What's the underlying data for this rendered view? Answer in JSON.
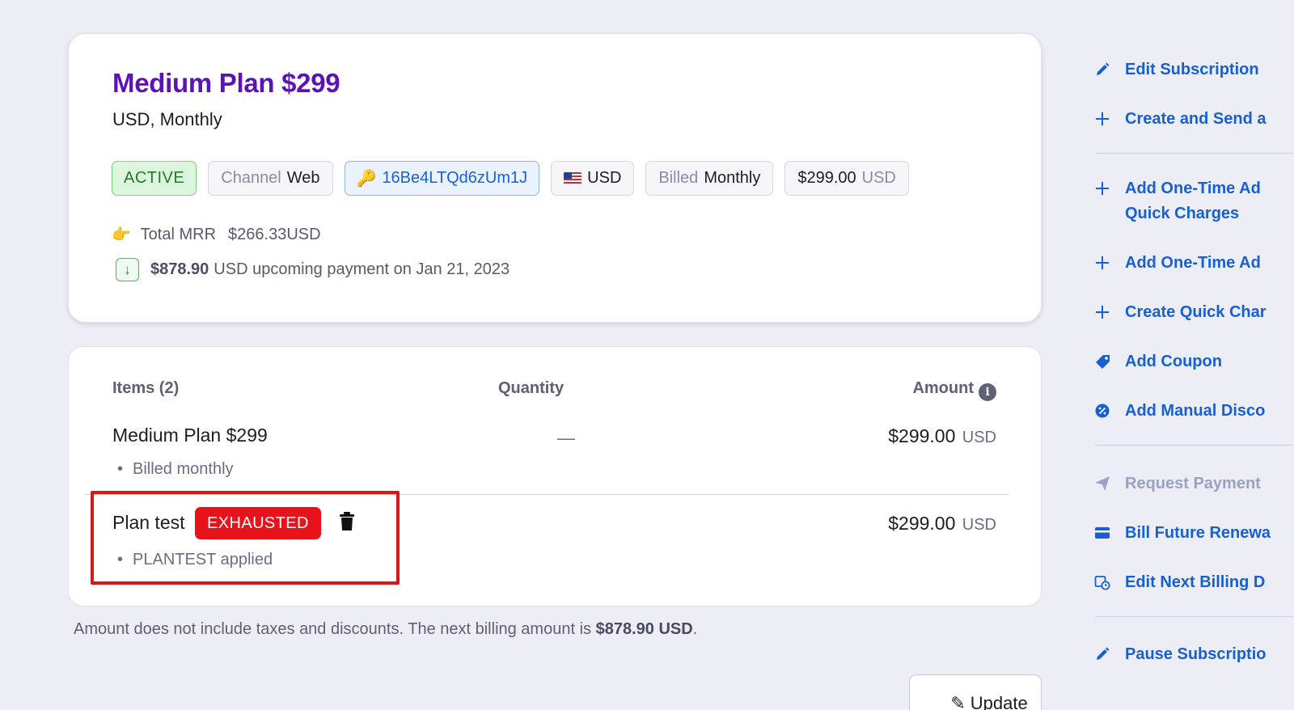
{
  "plan": {
    "title": "Medium Plan $299",
    "subtitle": "USD, Monthly",
    "chips": {
      "status": "ACTIVE",
      "channel_label": "Channel",
      "channel_value": "Web",
      "subscription_id": "16Be4LTQd6zUm1J",
      "currency": "USD",
      "billed_label": "Billed",
      "billed_value": "Monthly",
      "price": "$299.00",
      "price_currency": "USD"
    },
    "mrr_label": "Total MRR",
    "mrr_value": "$266.33USD",
    "upcoming_amount": "$878.90",
    "upcoming_text": "USD upcoming payment on Jan 21, 2023"
  },
  "items": {
    "header_items": "Items (2)",
    "header_quantity": "Quantity",
    "header_amount": "Amount",
    "rows": [
      {
        "name": "Medium Plan $299",
        "detail": "Billed monthly",
        "quantity": "—",
        "amount": "$299.00",
        "currency": "USD"
      },
      {
        "name": "Plan test",
        "badge": "EXHAUSTED",
        "detail": "PLANTEST applied",
        "amount": "$299.00",
        "currency": "USD"
      }
    ]
  },
  "footnote": {
    "text": "Amount does not include taxes and discounts. The next billing amount is",
    "amount": "$878.90 USD",
    "end": "."
  },
  "update_button": "Update",
  "sidebar": {
    "actions": [
      {
        "label": "Edit Subscription",
        "icon": "pencil-icon"
      },
      {
        "label": "Create and Send a",
        "icon": "plus-icon"
      },
      {
        "label": "Add One-Time Ad",
        "label2": "Quick Charges",
        "icon": "plus-icon"
      },
      {
        "label": "Add One-Time Ad",
        "icon": "plus-icon"
      },
      {
        "label": "Create Quick Char",
        "icon": "plus-icon"
      },
      {
        "label": "Add Coupon",
        "icon": "tag-icon"
      },
      {
        "label": "Add Manual Disco",
        "icon": "discount-badge-icon"
      },
      {
        "label": "Request Payment",
        "icon": "send-icon",
        "disabled": true
      },
      {
        "label": "Bill Future Renewa",
        "icon": "credit-card-icon"
      },
      {
        "label": "Edit Next Billing D",
        "icon": "calendar-clock-icon"
      },
      {
        "label": "Pause Subscriptio",
        "icon": "pencil-icon"
      }
    ]
  },
  "colors": {
    "plan_title": "#5b12b8",
    "link_blue": "#1860d1",
    "active_green": "#237a2d",
    "exhausted_red": "#e8131a",
    "highlight_red": "#d51818"
  }
}
